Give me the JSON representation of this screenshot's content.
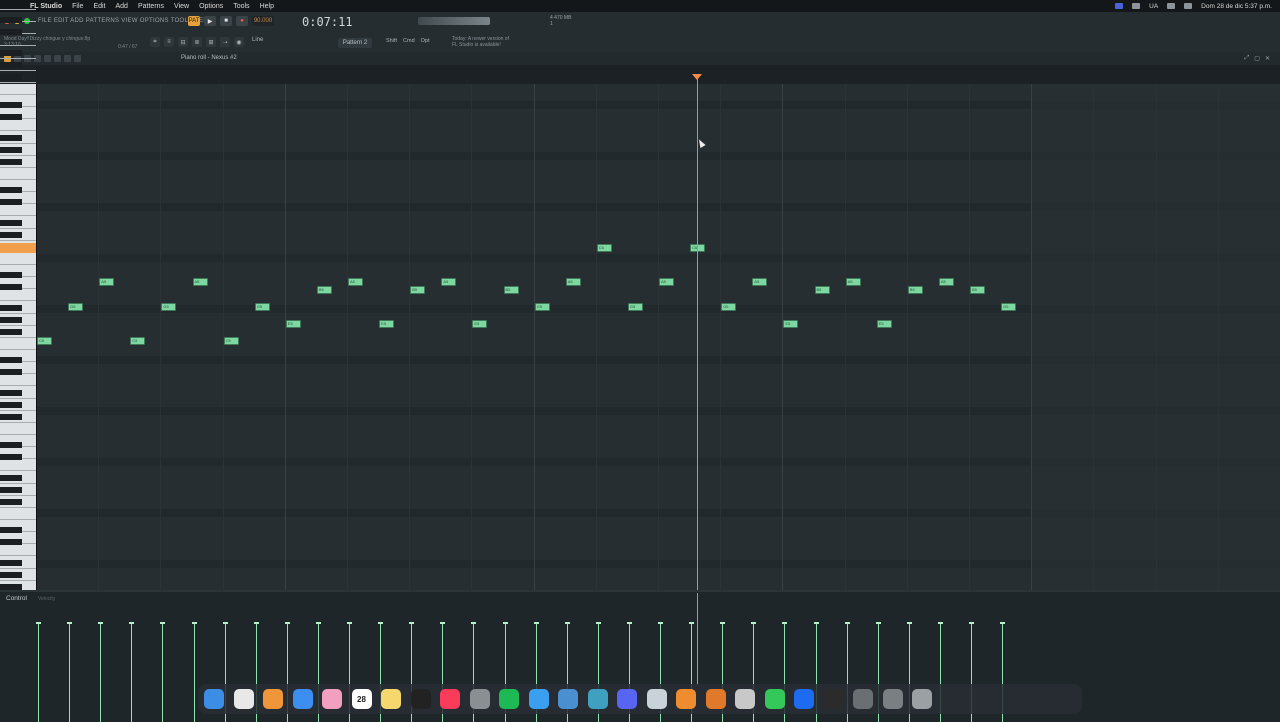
{
  "menubar": {
    "app_name": "FL Studio",
    "items": [
      "File",
      "Edit",
      "Add",
      "Patterns",
      "View",
      "Options",
      "Tools",
      "Help"
    ],
    "clock": "Dom 28 de dic  5:37 p.m.",
    "lang": "UA"
  },
  "toolbar": {
    "in_app_menu": "FILE  EDIT  ADD  PATTERNS  VIEW  OPTIONS  TOOLS  HELP",
    "bpm": "90.000",
    "time": "0:07:11",
    "pattern": "Pattern 2",
    "mode_label": "Line",
    "hint_line1": "Today: A newer version of",
    "hint_line2": "FL Studio is available!",
    "cpu_line1": "4   470 MB",
    "cpu_line2": "1",
    "project_line1": "Mood Day!!Dizzy chingue y chingue.flp",
    "project_line2": "3:13:10",
    "project_extra": "0:47 / 67",
    "buttons": {
      "shift": "Shift",
      "cmd": "Cmd",
      "opt": "Opt"
    }
  },
  "piano_roll": {
    "title": "Piano roll - Nexus #2",
    "note_color": "#7ed6a0",
    "playhead_color": "#ff7a3a",
    "highlight_key_color": "#f0a04a"
  },
  "control": {
    "label": "Control",
    "sublabel": "Velocity"
  },
  "notes": [
    {
      "col": 0,
      "row": 5,
      "label": "C5"
    },
    {
      "col": 1,
      "row": 3,
      "label": "G5"
    },
    {
      "col": 2,
      "row": 1,
      "label": "A5"
    },
    {
      "col": 3,
      "row": 5,
      "label": "C5"
    },
    {
      "col": 4,
      "row": 3,
      "label": "G5"
    },
    {
      "col": 5,
      "row": 1,
      "label": "A5"
    },
    {
      "col": 6,
      "row": 5,
      "label": "C5"
    },
    {
      "col": 7,
      "row": 3,
      "label": "G5"
    },
    {
      "col": 8,
      "row": 4,
      "label": "E5"
    },
    {
      "col": 9,
      "row": 2,
      "label": "B5"
    },
    {
      "col": 10,
      "row": 1,
      "label": "A5"
    },
    {
      "col": 11,
      "row": 4,
      "label": "E5"
    },
    {
      "col": 12,
      "row": 2,
      "label": "B5"
    },
    {
      "col": 13,
      "row": 1,
      "label": "A5"
    },
    {
      "col": 14,
      "row": 4,
      "label": "E5"
    },
    {
      "col": 15,
      "row": 2,
      "label": "B5"
    },
    {
      "col": 16,
      "row": 3,
      "label": "G5"
    },
    {
      "col": 17,
      "row": 1,
      "label": "A5"
    },
    {
      "col": 18,
      "row": 0,
      "label": "C6"
    },
    {
      "col": 19,
      "row": 3,
      "label": "G5"
    },
    {
      "col": 20,
      "row": 1,
      "label": "A5"
    },
    {
      "col": 21,
      "row": 0,
      "label": "C6"
    },
    {
      "col": 22,
      "row": 3,
      "label": "G5"
    },
    {
      "col": 23,
      "row": 1,
      "label": "A5"
    },
    {
      "col": 24,
      "row": 4,
      "label": "E5"
    },
    {
      "col": 25,
      "row": 2,
      "label": "B5"
    },
    {
      "col": 26,
      "row": 1,
      "label": "A5"
    },
    {
      "col": 27,
      "row": 4,
      "label": "E5"
    },
    {
      "col": 28,
      "row": 2,
      "label": "B5"
    },
    {
      "col": 29,
      "row": 1,
      "label": "A5"
    },
    {
      "col": 30,
      "row": 2,
      "label": "B5"
    },
    {
      "col": 31,
      "row": 3,
      "label": "G5"
    }
  ],
  "dock": {
    "icons": [
      "finder-icon",
      "chrome-icon",
      "fl-studio-icon",
      "app-store-icon",
      "photos-icon",
      "calendar-icon",
      "notes-icon",
      "apple-tv-icon",
      "music-icon",
      "settings-icon",
      "spotify-icon",
      "safari-icon",
      "audio-unit-icon",
      "time-machine-icon",
      "discord-icon",
      "text-edit-icon",
      "fl-studio-alt-icon",
      "fl-studio-alt2-icon",
      "roblox-icon",
      "facetime-icon",
      "shazam-icon",
      "terminal-icon",
      "activity-icon",
      "launchpad-icon",
      "trash-icon"
    ],
    "calendar_day": "28"
  }
}
